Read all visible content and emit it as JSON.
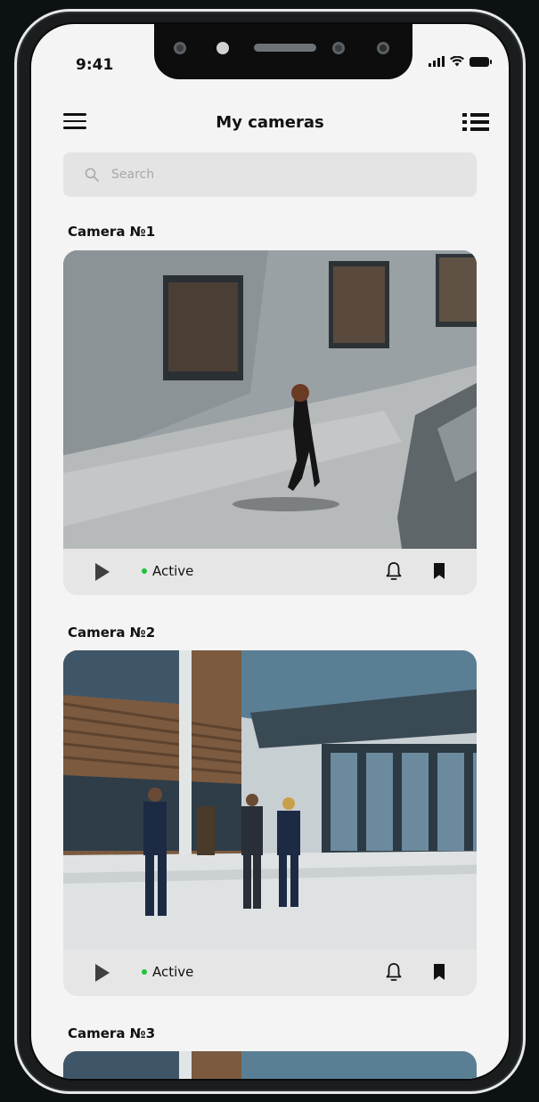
{
  "status_bar": {
    "time": "9:41"
  },
  "header": {
    "title": "My cameras"
  },
  "search": {
    "placeholder": "Search"
  },
  "cameras": [
    {
      "title": "Camera №1",
      "status": "Active"
    },
    {
      "title": "Camera №2",
      "status": "Active"
    },
    {
      "title": "Camera №3"
    }
  ],
  "colors": {
    "active_dot": "#1fbf3c",
    "background": "#f4f4f4",
    "card_bg": "#e6e6e6"
  },
  "icons": [
    "menu-icon",
    "list-view-icon",
    "search-icon",
    "play-icon",
    "bell-icon",
    "bookmark-icon"
  ]
}
